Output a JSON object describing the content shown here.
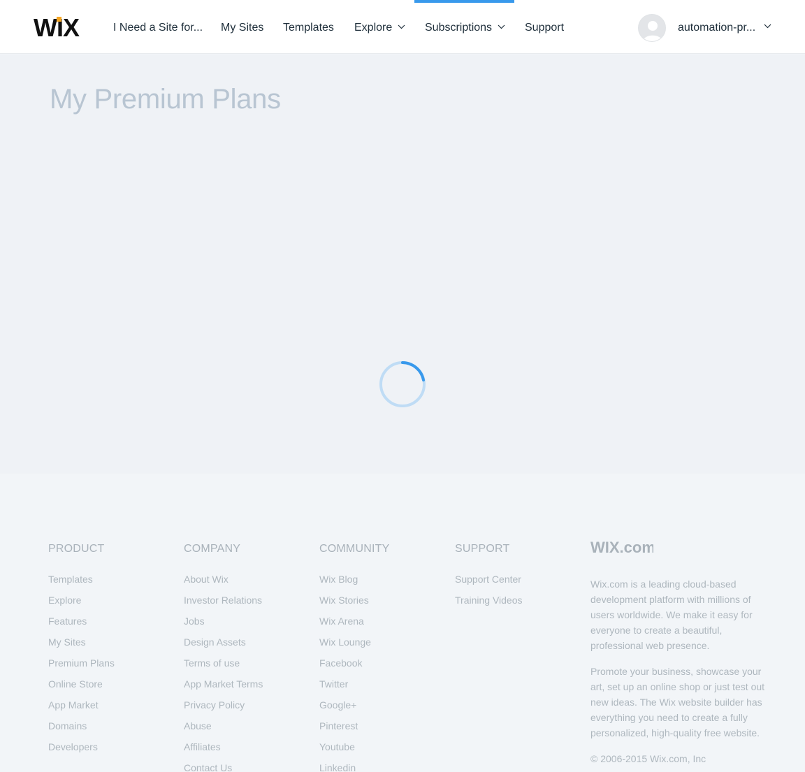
{
  "header": {
    "logo_text": "WIX",
    "nav": [
      {
        "label": "I Need a Site for..."
      },
      {
        "label": "My Sites"
      },
      {
        "label": "Templates"
      },
      {
        "label": "Explore"
      },
      {
        "label": "Subscriptions"
      },
      {
        "label": "Support"
      }
    ],
    "active_nav": "Subscriptions",
    "user_name": "automation-pr..."
  },
  "main": {
    "title": "My Premium Plans",
    "loading_icon": "spinner-icon"
  },
  "footer": {
    "columns": [
      {
        "heading": "PRODUCT",
        "links": [
          "Templates",
          "Explore",
          "Features",
          "My Sites",
          "Premium Plans",
          "Online Store",
          "App Market",
          "Domains",
          "Developers"
        ]
      },
      {
        "heading": "COMPANY",
        "links": [
          "About Wix",
          "Investor Relations",
          "Jobs",
          "Design Assets",
          "Terms of use",
          "App Market Terms",
          "Privacy Policy",
          "Abuse",
          "Affiliates",
          "Contact Us"
        ]
      },
      {
        "heading": "COMMUNITY",
        "links": [
          "Wix Blog",
          "Wix Stories",
          "Wix Arena",
          "Wix Lounge",
          "Facebook",
          "Twitter",
          "Google+",
          "Pinterest",
          "Youtube",
          "Linkedin"
        ]
      },
      {
        "heading": "SUPPORT",
        "links": [
          "Support Center",
          "Training Videos"
        ]
      }
    ],
    "about": {
      "logo_text": "WIX.com",
      "paragraph1": "Wix.com is a leading cloud-based development platform with millions of users worldwide. We make it easy for everyone to create a beautiful, professional web presence.",
      "paragraph2": "Promote your business, showcase your art, set up an online shop or just test out new ideas. The Wix website builder has everything you need to create a fully personalized, high-quality free website.",
      "copyright": "© 2006-2015 Wix.com, Inc"
    }
  },
  "colors": {
    "accent": "#3899ec",
    "page_bg": "#eff2f6",
    "title": "#b8c5d2",
    "footer_text": "#aeb7be"
  }
}
